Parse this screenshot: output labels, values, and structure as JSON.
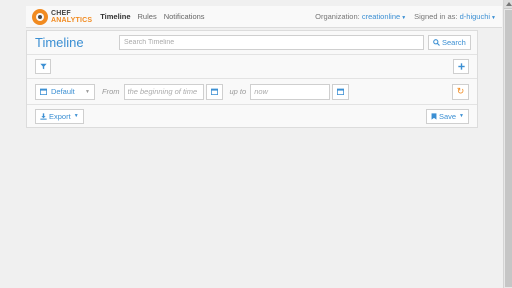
{
  "brand": {
    "line1": "CHEF",
    "line2": "ANALYTICS"
  },
  "nav": {
    "links": [
      {
        "label": "Timeline",
        "active": true
      },
      {
        "label": "Rules",
        "active": false
      },
      {
        "label": "Notifications",
        "active": false
      }
    ],
    "organization_label": "Organization:",
    "organization_value": "creationline",
    "signed_in_label": "Signed in as:",
    "signed_in_value": "d-higuchi"
  },
  "timeline": {
    "title": "Timeline",
    "search_placeholder": "Search Timeline",
    "search_button": "Search"
  },
  "range": {
    "preset": "Default",
    "from_label": "From",
    "from_placeholder": "the beginning of time",
    "to_label": "up to",
    "to_placeholder": "now"
  },
  "actions": {
    "export_label": "Export",
    "save_label": "Save"
  },
  "colors": {
    "accent": "#3b8fd3",
    "brand_orange": "#f18b21"
  },
  "icons": [
    "filter-icon",
    "plus-icon",
    "calendar-icon",
    "refresh-icon",
    "download-icon",
    "bookmark-icon",
    "search-icon"
  ]
}
